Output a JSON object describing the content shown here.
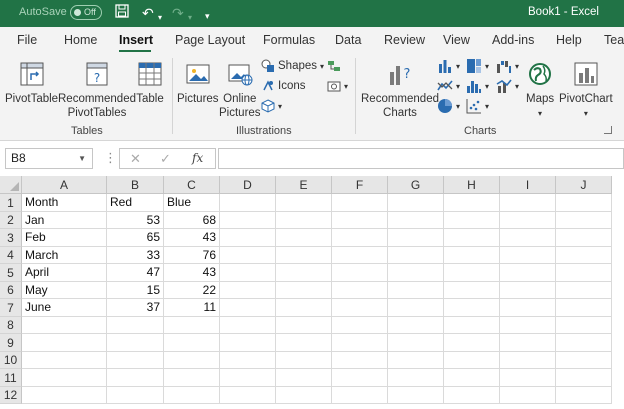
{
  "titlebar": {
    "autosave_label": "AutoSave",
    "autosave_state": "Off",
    "title": "Book1  -  Excel",
    "accent": "#217346"
  },
  "tabs": [
    {
      "label": "File"
    },
    {
      "label": "Home"
    },
    {
      "label": "Insert",
      "active": true
    },
    {
      "label": "Page Layout"
    },
    {
      "label": "Formulas"
    },
    {
      "label": "Data"
    },
    {
      "label": "Review"
    },
    {
      "label": "View"
    },
    {
      "label": "Add-ins"
    },
    {
      "label": "Help"
    },
    {
      "label": "Tear"
    }
  ],
  "ribbon": {
    "tables": {
      "label": "Tables",
      "pivottable": "PivotTable",
      "recommended_line1": "Recommended",
      "recommended_line2": "PivotTables",
      "table": "Table"
    },
    "illustrations": {
      "label": "Illustrations",
      "pictures": "Pictures",
      "online_line1": "Online",
      "online_line2": "Pictures",
      "shapes": "Shapes",
      "icons": "Icons"
    },
    "charts": {
      "label": "Charts",
      "recommended_line1": "Recommended",
      "recommended_line2": "Charts",
      "maps": "Maps",
      "pivotchart": "PivotChart"
    }
  },
  "formula_bar": {
    "name_box": "B8",
    "fx": "fx",
    "value": ""
  },
  "sheet": {
    "columns": [
      "A",
      "B",
      "C",
      "D",
      "E",
      "F",
      "G",
      "H",
      "I",
      "J"
    ],
    "rows": [
      "1",
      "2",
      "3",
      "4",
      "5",
      "6",
      "7",
      "8",
      "9",
      "10",
      "11",
      "12"
    ],
    "cells": [
      [
        "Month",
        "Red",
        "Blue"
      ],
      [
        "Jan",
        "53",
        "68"
      ],
      [
        "Feb",
        "65",
        "43"
      ],
      [
        "March",
        "33",
        "76"
      ],
      [
        "April",
        "47",
        "43"
      ],
      [
        "May",
        "15",
        "22"
      ],
      [
        "June",
        "37",
        "11"
      ]
    ]
  }
}
